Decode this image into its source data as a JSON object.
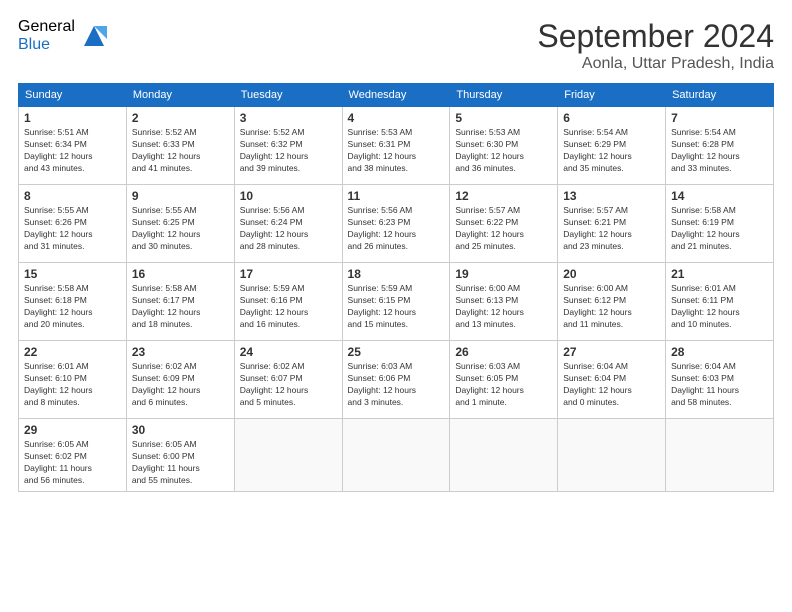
{
  "header": {
    "logo_line1": "General",
    "logo_line2": "Blue",
    "title": "September 2024",
    "location": "Aonla, Uttar Pradesh, India"
  },
  "weekdays": [
    "Sunday",
    "Monday",
    "Tuesday",
    "Wednesday",
    "Thursday",
    "Friday",
    "Saturday"
  ],
  "weeks": [
    [
      {
        "num": "1",
        "info": "Sunrise: 5:51 AM\nSunset: 6:34 PM\nDaylight: 12 hours\nand 43 minutes."
      },
      {
        "num": "2",
        "info": "Sunrise: 5:52 AM\nSunset: 6:33 PM\nDaylight: 12 hours\nand 41 minutes."
      },
      {
        "num": "3",
        "info": "Sunrise: 5:52 AM\nSunset: 6:32 PM\nDaylight: 12 hours\nand 39 minutes."
      },
      {
        "num": "4",
        "info": "Sunrise: 5:53 AM\nSunset: 6:31 PM\nDaylight: 12 hours\nand 38 minutes."
      },
      {
        "num": "5",
        "info": "Sunrise: 5:53 AM\nSunset: 6:30 PM\nDaylight: 12 hours\nand 36 minutes."
      },
      {
        "num": "6",
        "info": "Sunrise: 5:54 AM\nSunset: 6:29 PM\nDaylight: 12 hours\nand 35 minutes."
      },
      {
        "num": "7",
        "info": "Sunrise: 5:54 AM\nSunset: 6:28 PM\nDaylight: 12 hours\nand 33 minutes."
      }
    ],
    [
      {
        "num": "8",
        "info": "Sunrise: 5:55 AM\nSunset: 6:26 PM\nDaylight: 12 hours\nand 31 minutes."
      },
      {
        "num": "9",
        "info": "Sunrise: 5:55 AM\nSunset: 6:25 PM\nDaylight: 12 hours\nand 30 minutes."
      },
      {
        "num": "10",
        "info": "Sunrise: 5:56 AM\nSunset: 6:24 PM\nDaylight: 12 hours\nand 28 minutes."
      },
      {
        "num": "11",
        "info": "Sunrise: 5:56 AM\nSunset: 6:23 PM\nDaylight: 12 hours\nand 26 minutes."
      },
      {
        "num": "12",
        "info": "Sunrise: 5:57 AM\nSunset: 6:22 PM\nDaylight: 12 hours\nand 25 minutes."
      },
      {
        "num": "13",
        "info": "Sunrise: 5:57 AM\nSunset: 6:21 PM\nDaylight: 12 hours\nand 23 minutes."
      },
      {
        "num": "14",
        "info": "Sunrise: 5:58 AM\nSunset: 6:19 PM\nDaylight: 12 hours\nand 21 minutes."
      }
    ],
    [
      {
        "num": "15",
        "info": "Sunrise: 5:58 AM\nSunset: 6:18 PM\nDaylight: 12 hours\nand 20 minutes."
      },
      {
        "num": "16",
        "info": "Sunrise: 5:58 AM\nSunset: 6:17 PM\nDaylight: 12 hours\nand 18 minutes."
      },
      {
        "num": "17",
        "info": "Sunrise: 5:59 AM\nSunset: 6:16 PM\nDaylight: 12 hours\nand 16 minutes."
      },
      {
        "num": "18",
        "info": "Sunrise: 5:59 AM\nSunset: 6:15 PM\nDaylight: 12 hours\nand 15 minutes."
      },
      {
        "num": "19",
        "info": "Sunrise: 6:00 AM\nSunset: 6:13 PM\nDaylight: 12 hours\nand 13 minutes."
      },
      {
        "num": "20",
        "info": "Sunrise: 6:00 AM\nSunset: 6:12 PM\nDaylight: 12 hours\nand 11 minutes."
      },
      {
        "num": "21",
        "info": "Sunrise: 6:01 AM\nSunset: 6:11 PM\nDaylight: 12 hours\nand 10 minutes."
      }
    ],
    [
      {
        "num": "22",
        "info": "Sunrise: 6:01 AM\nSunset: 6:10 PM\nDaylight: 12 hours\nand 8 minutes."
      },
      {
        "num": "23",
        "info": "Sunrise: 6:02 AM\nSunset: 6:09 PM\nDaylight: 12 hours\nand 6 minutes."
      },
      {
        "num": "24",
        "info": "Sunrise: 6:02 AM\nSunset: 6:07 PM\nDaylight: 12 hours\nand 5 minutes."
      },
      {
        "num": "25",
        "info": "Sunrise: 6:03 AM\nSunset: 6:06 PM\nDaylight: 12 hours\nand 3 minutes."
      },
      {
        "num": "26",
        "info": "Sunrise: 6:03 AM\nSunset: 6:05 PM\nDaylight: 12 hours\nand 1 minute."
      },
      {
        "num": "27",
        "info": "Sunrise: 6:04 AM\nSunset: 6:04 PM\nDaylight: 12 hours\nand 0 minutes."
      },
      {
        "num": "28",
        "info": "Sunrise: 6:04 AM\nSunset: 6:03 PM\nDaylight: 11 hours\nand 58 minutes."
      }
    ],
    [
      {
        "num": "29",
        "info": "Sunrise: 6:05 AM\nSunset: 6:02 PM\nDaylight: 11 hours\nand 56 minutes."
      },
      {
        "num": "30",
        "info": "Sunrise: 6:05 AM\nSunset: 6:00 PM\nDaylight: 11 hours\nand 55 minutes."
      },
      null,
      null,
      null,
      null,
      null
    ]
  ]
}
